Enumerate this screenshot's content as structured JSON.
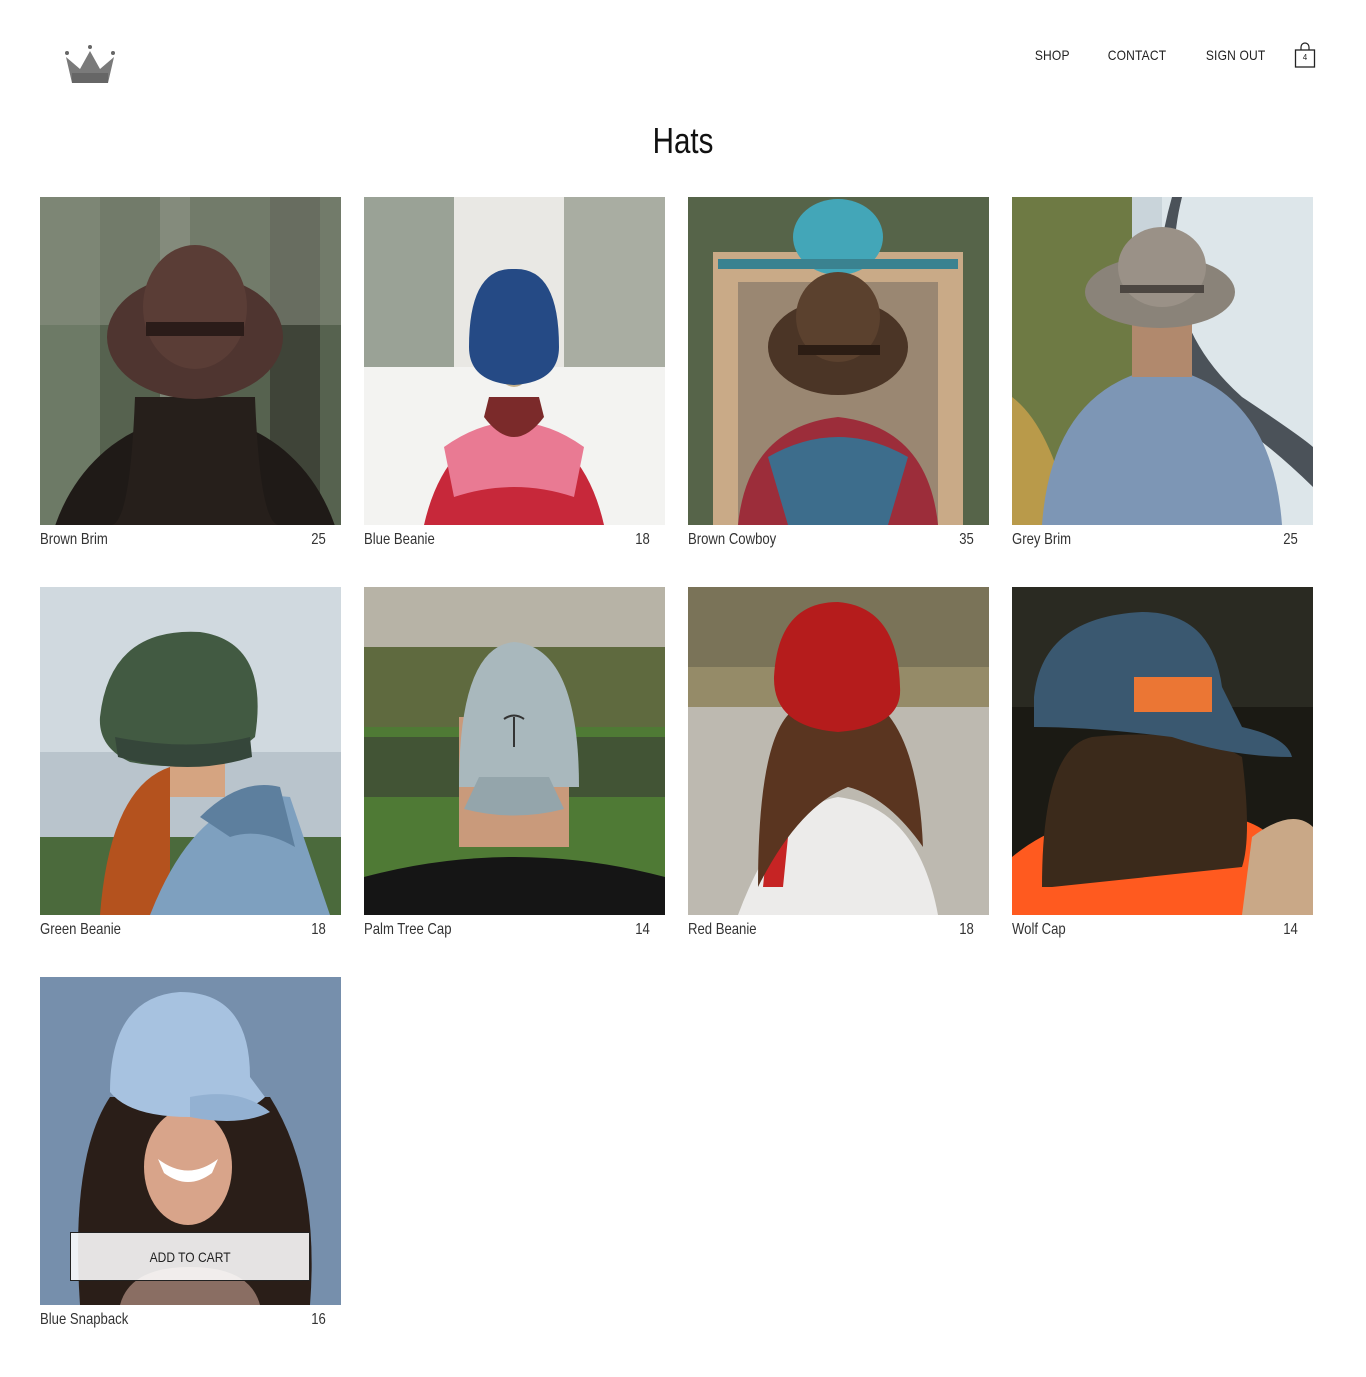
{
  "header": {
    "logo_icon": "crown-icon",
    "nav": [
      {
        "label": "SHOP"
      },
      {
        "label": "CONTACT"
      },
      {
        "label": "SIGN OUT"
      }
    ],
    "cart": {
      "icon": "shopping-bag-icon",
      "count": "4"
    }
  },
  "page": {
    "title": "Hats"
  },
  "products": [
    {
      "name": "Brown Brim",
      "price": "25"
    },
    {
      "name": "Blue Beanie",
      "price": "18"
    },
    {
      "name": "Brown Cowboy",
      "price": "35"
    },
    {
      "name": "Grey Brim",
      "price": "25"
    },
    {
      "name": "Green Beanie",
      "price": "18"
    },
    {
      "name": "Palm Tree Cap",
      "price": "14"
    },
    {
      "name": "Red Beanie",
      "price": "18"
    },
    {
      "name": "Wolf Cap",
      "price": "14"
    },
    {
      "name": "Blue Snapback",
      "price": "16",
      "button_label": "ADD TO CART"
    }
  ]
}
